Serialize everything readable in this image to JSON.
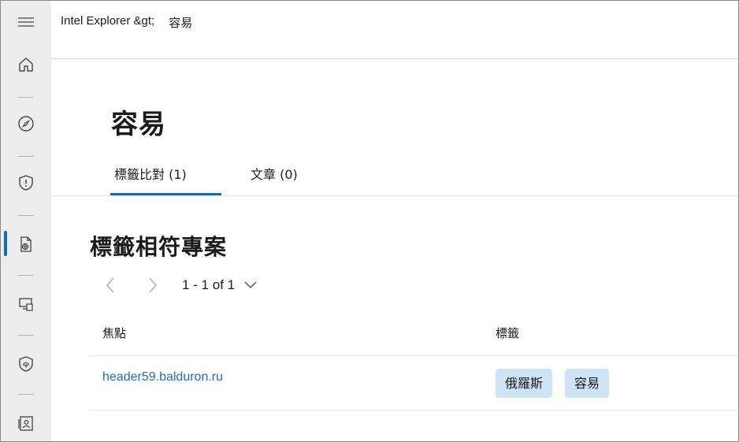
{
  "breadcrumb": {
    "root": "Intel Explorer &gt;",
    "current": "容易"
  },
  "page": {
    "title": "容易"
  },
  "tabs": [
    {
      "label": "標籤比對 (1)",
      "active": true
    },
    {
      "label": "文章 (0)",
      "active": false
    }
  ],
  "section": {
    "title": "標籤相符專案"
  },
  "pager": {
    "range": "1 - 1 of 1"
  },
  "table": {
    "headers": [
      "焦點",
      "標籤"
    ],
    "rows": [
      {
        "focus": "header59.balduron.ru",
        "tags": [
          "俄羅斯",
          "容易"
        ]
      }
    ]
  },
  "rail": {
    "icons": [
      "menu-icon",
      "home-icon",
      "compass-icon",
      "shield-alert-icon",
      "document-globe-icon",
      "devices-icon",
      "shield-fingerprint-icon",
      "contact-card-icon"
    ],
    "active_index": 4
  },
  "colors": {
    "accent": "#0f6cbd",
    "link": "#1f6fb8",
    "tag_bg": "#cfe3f6",
    "rail_bg": "#ececec"
  }
}
